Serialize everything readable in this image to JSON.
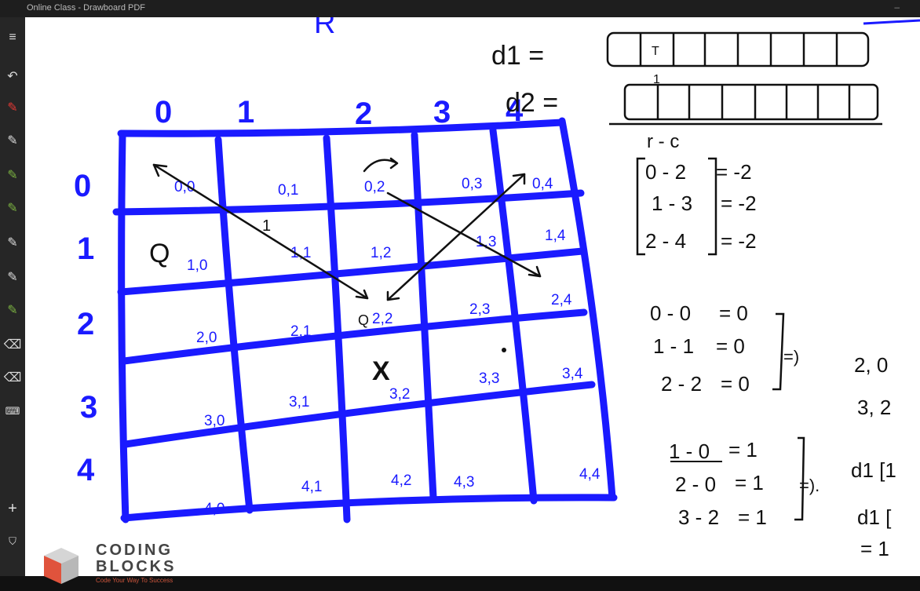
{
  "window": {
    "title": "Online Class - Drawboard PDF",
    "control": "–"
  },
  "toolbar": {
    "items": [
      {
        "name": "menu-icon",
        "glyph": "≡"
      },
      {
        "name": "undo-icon",
        "glyph": "↶"
      },
      {
        "name": "pen-icon",
        "glyph": "✎"
      },
      {
        "name": "pen-icon",
        "glyph": "✎"
      },
      {
        "name": "pen-icon",
        "glyph": "✎"
      },
      {
        "name": "pen-icon",
        "glyph": "✎"
      },
      {
        "name": "pen-icon",
        "glyph": "✎"
      },
      {
        "name": "pen-icon",
        "glyph": "✎"
      },
      {
        "name": "pen-icon",
        "glyph": "✎"
      },
      {
        "name": "eraser-icon",
        "glyph": "⌫"
      },
      {
        "name": "eraser-icon",
        "glyph": "⌫"
      },
      {
        "name": "keyboard-icon",
        "glyph": "⌨"
      }
    ],
    "add": "+",
    "bottom": "⛉",
    "colors": {
      "pen_red": "#e53935",
      "pen_green": "#7cb342",
      "bg": "#262626"
    }
  },
  "board": {
    "ink_blue": "#1a1aff",
    "col_headers": [
      "0",
      "1",
      "2",
      "3",
      "4"
    ],
    "row_headers": [
      "0",
      "1",
      "2",
      "3",
      "4"
    ],
    "cell_labels": [
      [
        "0,0",
        "0,1",
        "0,2",
        "0,3",
        "0,4"
      ],
      [
        "1,0",
        "1,1",
        "1,2",
        "1,3",
        "1,4"
      ],
      [
        "2,0",
        "2,1",
        "2,2",
        "2,3",
        "2,4"
      ],
      [
        "3,0",
        "3,1",
        "3,2",
        "3,3",
        "3,4"
      ],
      [
        "4,0",
        "4,1",
        "4,2",
        "4,3",
        "4,4"
      ]
    ],
    "queen_marks": [
      "Q",
      "Q"
    ],
    "blocked_mark": "X",
    "arrow_label": "1"
  },
  "notes": {
    "top_letter": "R",
    "d1": "d1 =",
    "d2": "d2 =",
    "d1_box_mark": "T",
    "d2_box_mark": "1",
    "rc_header": "r - c",
    "rc_lines": [
      {
        "lhs": "0 - 2",
        "rhs": "= -2"
      },
      {
        "lhs": "1 - 3",
        "rhs": "= -2"
      },
      {
        "lhs": "2 - 4",
        "rhs": "= -2"
      }
    ],
    "diag_lines": [
      {
        "lhs": "0 - 0",
        "rhs": "= 0"
      },
      {
        "lhs": "1 - 1",
        "rhs": "= 0"
      },
      {
        "lhs": "2 - 2",
        "rhs": "= 0"
      }
    ],
    "implies": "=)",
    "diag_results": [
      "2, 0",
      "3, 2"
    ],
    "ones_lines": [
      {
        "lhs": "1 - 0",
        "rhs": "= 1"
      },
      {
        "lhs": "2 - 0",
        "rhs": "= 1"
      },
      {
        "lhs": "3 - 2",
        "rhs": "= 1"
      }
    ],
    "implies2": "=).",
    "d1_ref_1": "d1 [1",
    "d1_ref_2": "d1 [",
    "d1_ref_3": "= 1"
  },
  "branding": {
    "line1": "CODING",
    "line2": "BLOCKS",
    "tagline": "Code Your Way To Success",
    "colors": {
      "red": "#e0533c",
      "grey": "#b8b8b8"
    }
  }
}
